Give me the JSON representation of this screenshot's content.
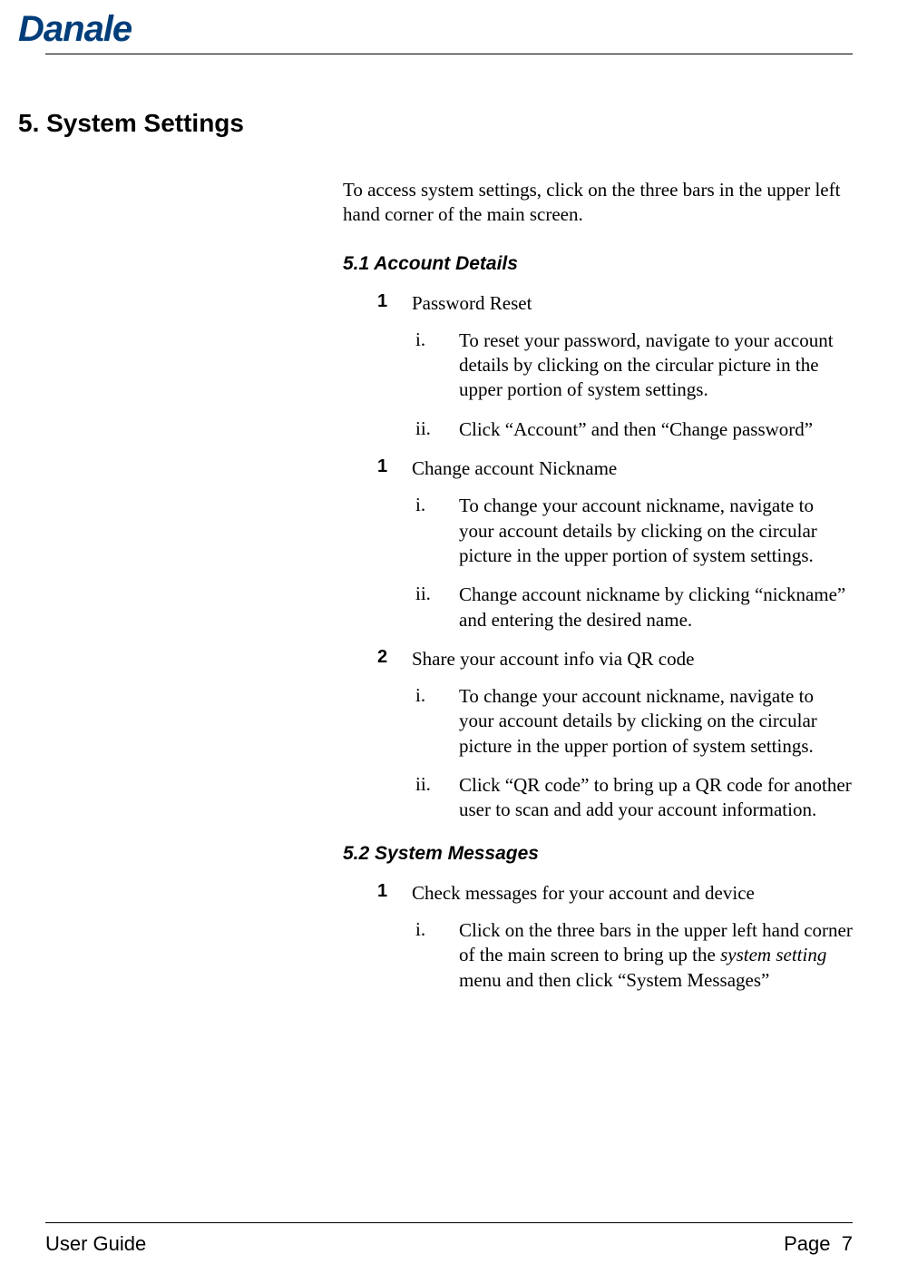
{
  "logo": "Danale",
  "section_title": "5. System Settings",
  "intro": "To access system settings, click on the three bars in the upper left hand corner of the main screen.",
  "sub51": "5.1 Account Details",
  "items51": [
    {
      "num": "1",
      "title": "Password Reset",
      "steps": [
        {
          "roman": "i.",
          "text": "To reset your password, navigate to your account details by clicking on the circular picture in the upper portion of system settings."
        },
        {
          "roman": "ii.",
          "text": "Click “Account” and then “Change password”"
        }
      ]
    },
    {
      "num": "1",
      "title": "Change account Nickname",
      "steps": [
        {
          "roman": "i.",
          "text": "To change your account nickname, navigate to your account details by clicking on the circular picture in the upper portion of system settings."
        },
        {
          "roman": "ii.",
          "text": "Change account nickname by clicking “nickname” and entering the desired name."
        }
      ]
    },
    {
      "num": "2",
      "title": "Share your account info via QR code",
      "steps": [
        {
          "roman": "i.",
          "text": "To change your account nickname, navigate to your account details by clicking on the circular picture in the upper portion of system settings."
        },
        {
          "roman": "ii.",
          "text": "Click “QR code” to bring up a QR code for another user to scan and add your account information."
        }
      ]
    }
  ],
  "sub52": "5.2 System Messages",
  "items52": [
    {
      "num": "1",
      "title": "Check messages for your account and device",
      "steps": [
        {
          "roman": "i.",
          "text_pre": "Click on the three bars in the upper left hand corner of the main screen to bring up the ",
          "text_italic": "system setting",
          "text_post": " menu and then click “System Messages”"
        }
      ]
    }
  ],
  "footer_left": "User Guide",
  "footer_right_label": "Page",
  "footer_right_num": "7"
}
